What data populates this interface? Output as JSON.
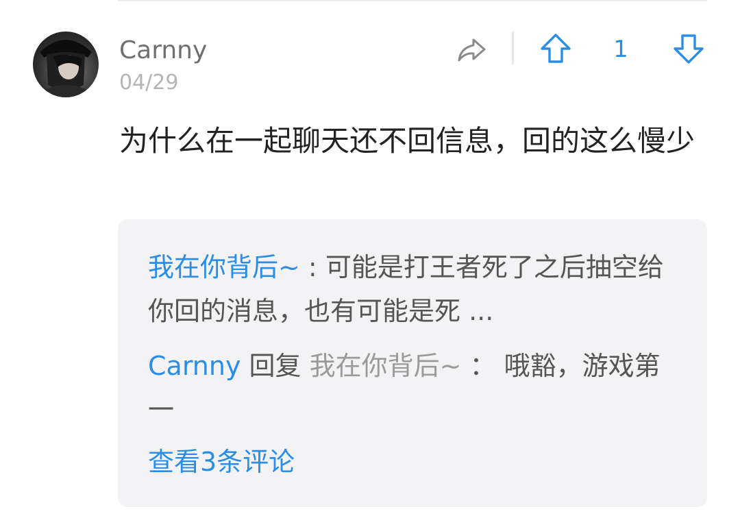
{
  "comment": {
    "username": "Carnny",
    "date": "04/29",
    "text": "为什么在一起聊天还不回信息，回的这么慢少",
    "vote_count": "1",
    "icons": {
      "share": "share-icon",
      "upvote": "upvote-icon",
      "downvote": "downvote-icon",
      "avatar": "avatar"
    }
  },
  "replies": [
    {
      "author": "我在你背后~",
      "separator": " : ",
      "text": "可能是打王者死了之后抽空给你回的消息，也有可能是死 ..."
    },
    {
      "author": "Carnny",
      "reply_word": " 回复 ",
      "target": "我在你背后~",
      "separator": " ： ",
      "text": "哦豁，游戏第一"
    }
  ],
  "view_more": "查看3条评论",
  "colors": {
    "accent": "#2a8ee6",
    "muted": "#9a9a9a",
    "reply_bg": "#f3f3f5"
  }
}
